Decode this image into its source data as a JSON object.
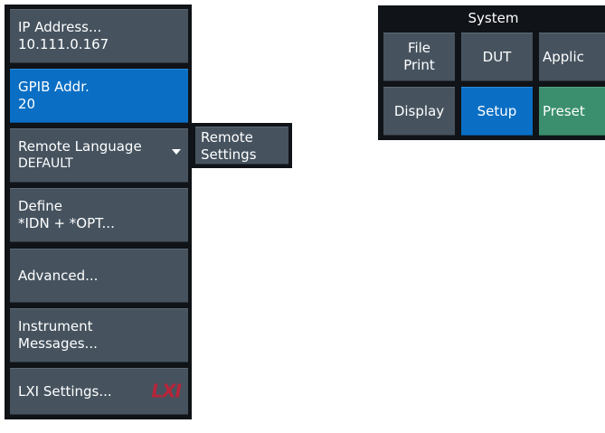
{
  "softkeys": [
    {
      "line1": "IP Address...",
      "line2": "10.111.0.167"
    },
    {
      "line1": "GPIB Addr.",
      "line2": "20"
    },
    {
      "line1": "Remote Language",
      "line2": "DEFAULT"
    },
    {
      "line1": "Define",
      "line2": "*IDN + *OPT..."
    },
    {
      "line1": "Advanced..."
    },
    {
      "line1": "Instrument",
      "line2": "Messages..."
    },
    {
      "line1": "LXI Settings...",
      "logo": "LXI"
    }
  ],
  "submenu": {
    "line1": "Remote",
    "line2": "Settings"
  },
  "system": {
    "title": "System",
    "buttons": [
      {
        "line1": "File",
        "line2": "Print"
      },
      {
        "line1": "DUT"
      },
      {
        "line1": "Applic"
      },
      {
        "line1": "Display"
      },
      {
        "line1": "Setup"
      },
      {
        "line1": "Preset"
      }
    ]
  },
  "colors": {
    "panel": "#101317",
    "softkey": "#46535f",
    "active": "#0a6fc4",
    "preset": "#3b8f6e",
    "lxi_logo": "#b7253a"
  },
  "icons": [
    "chevron-down-icon",
    "lxi-logo"
  ]
}
